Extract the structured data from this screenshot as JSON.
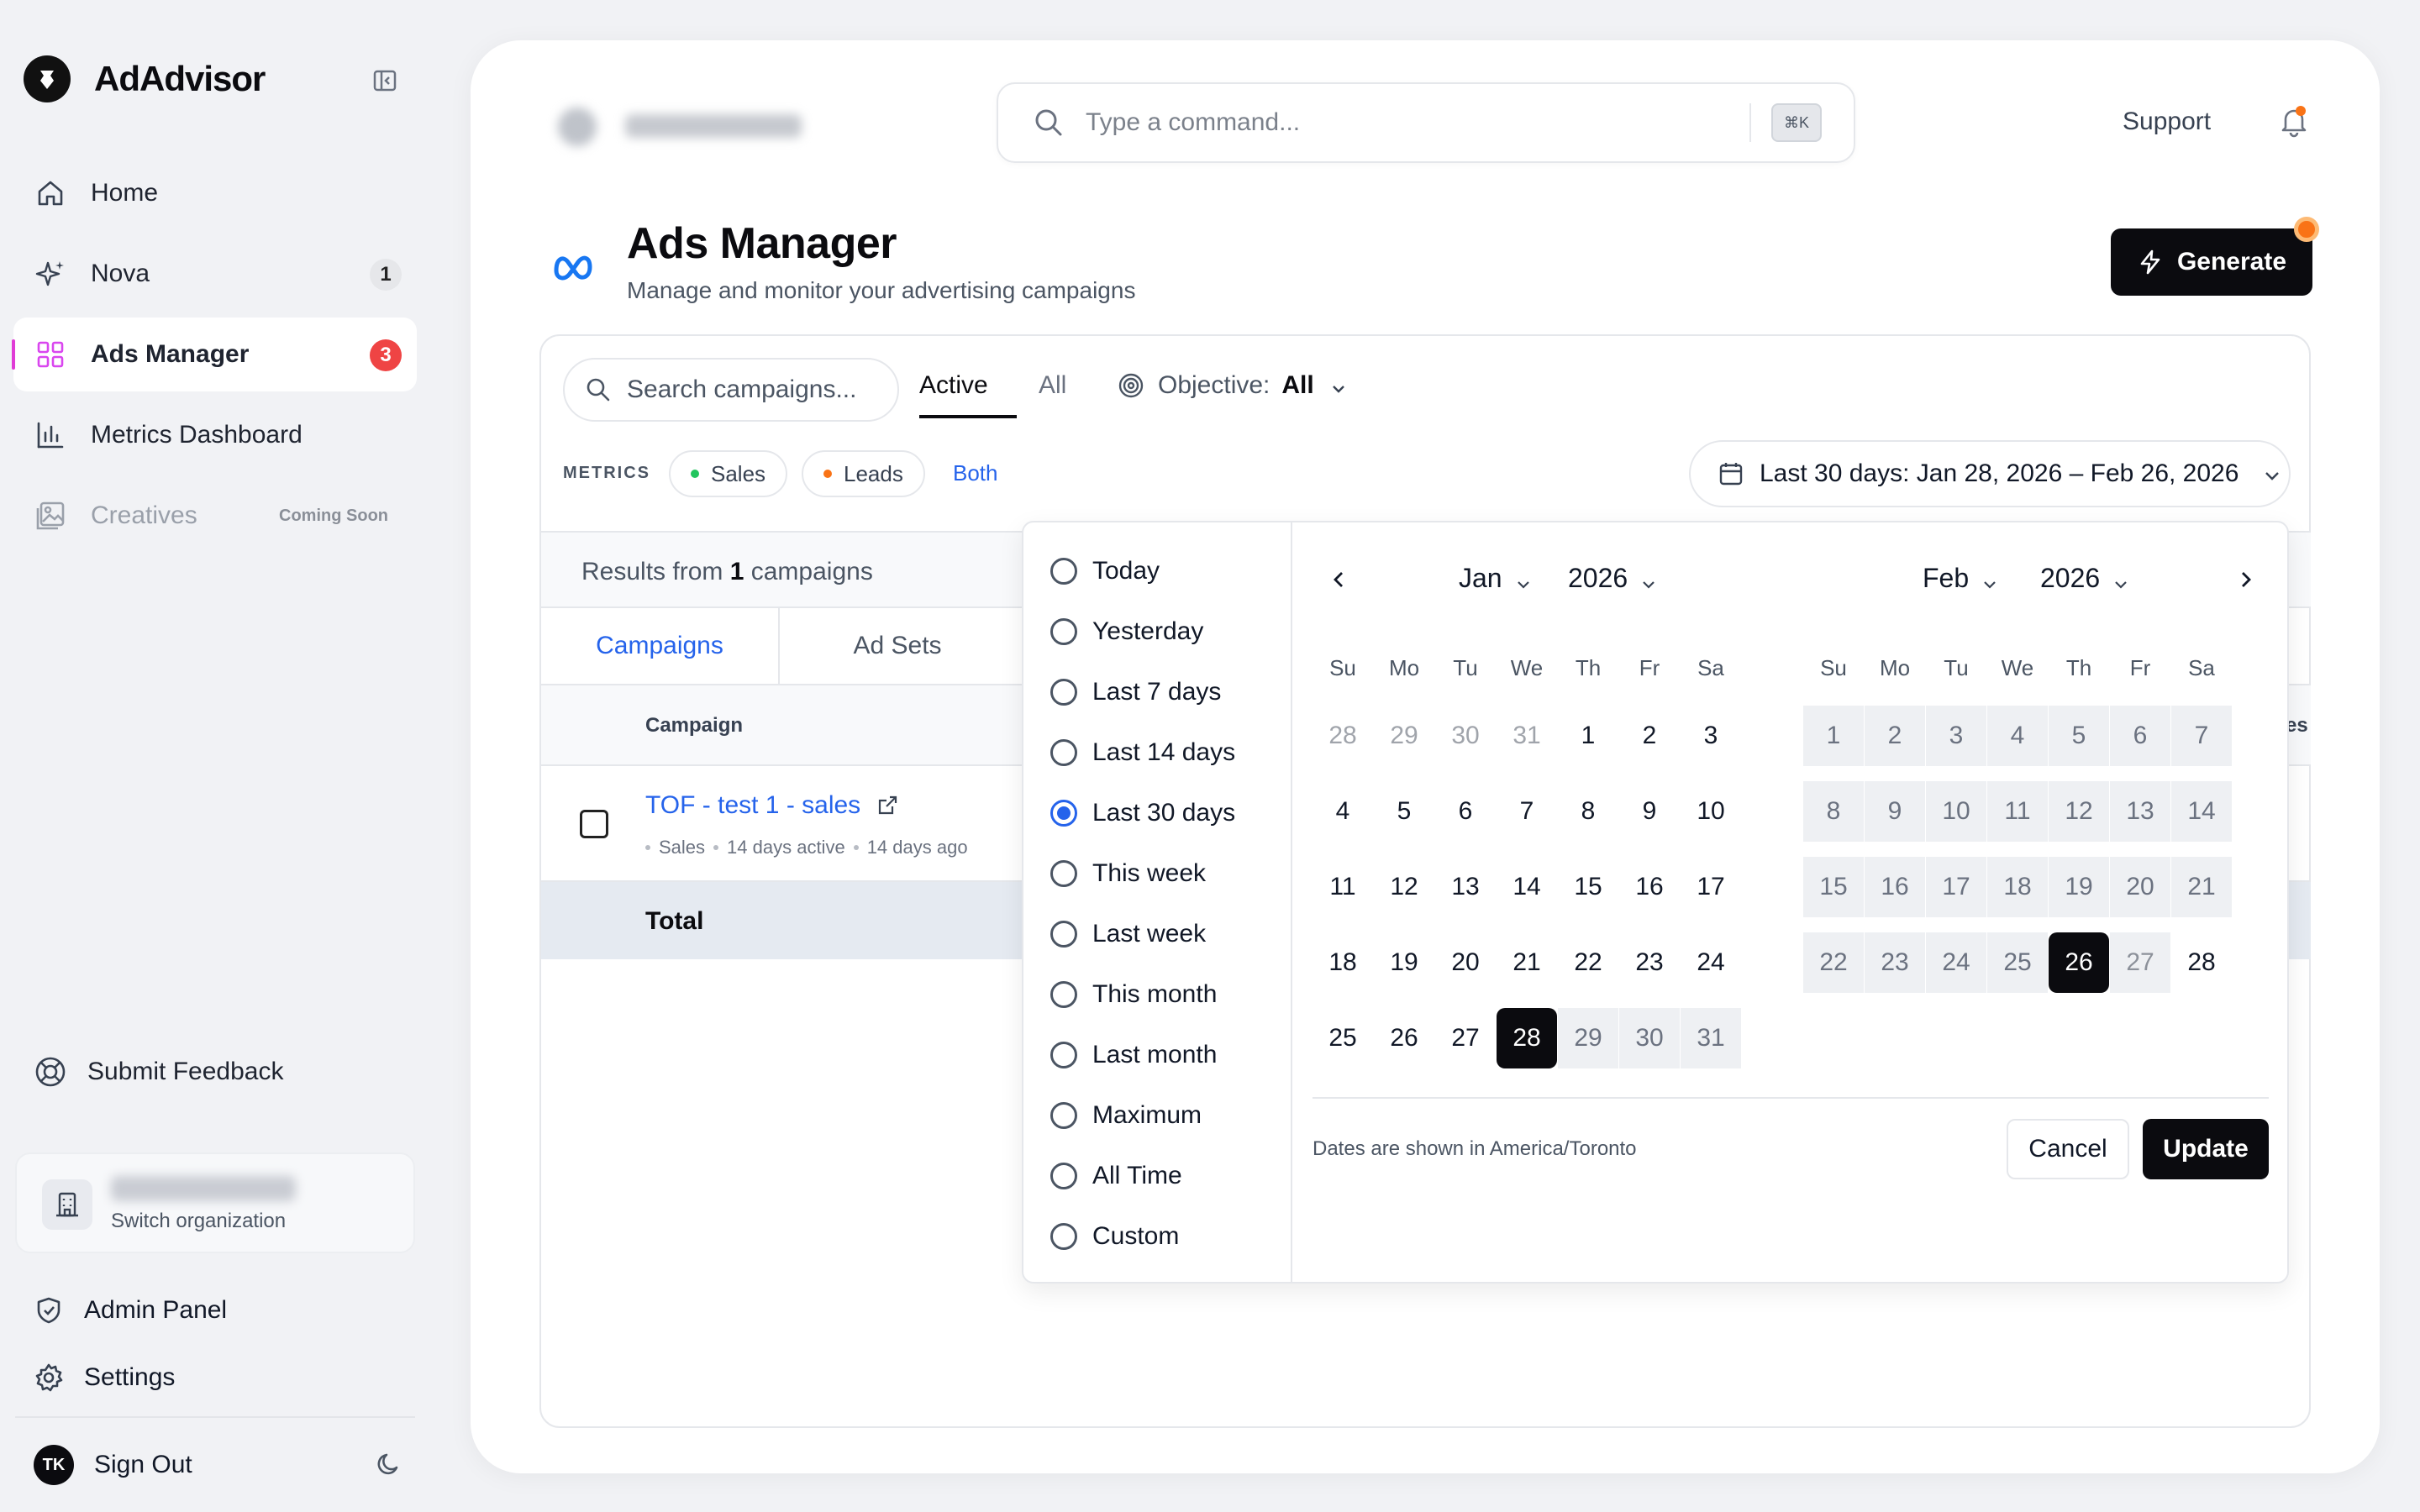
{
  "app": {
    "name": "AdAdvisor"
  },
  "sidebar": {
    "items": [
      {
        "label": "Home",
        "icon": "home-icon",
        "badge": ""
      },
      {
        "label": "Nova",
        "icon": "sparkle-icon",
        "badge": "1"
      },
      {
        "label": "Ads Manager",
        "icon": "grid-icon",
        "badge": "3",
        "active": true
      },
      {
        "label": "Metrics Dashboard",
        "icon": "bar-chart-icon",
        "badge": ""
      },
      {
        "label": "Creatives",
        "icon": "image-icon",
        "badge": "",
        "tag": "Coming Soon",
        "disabled": true
      }
    ],
    "feedback_label": "Submit Feedback",
    "org": {
      "switch_label": "Switch organization"
    },
    "admin_label": "Admin Panel",
    "settings_label": "Settings",
    "signout_label": "Sign Out",
    "avatar_initials": "TK"
  },
  "topbar": {
    "command_placeholder": "Type a command...",
    "shortcut": "⌘K",
    "support_label": "Support"
  },
  "page": {
    "title": "Ads Manager",
    "subtitle": "Manage and monitor your advertising campaigns",
    "generate_label": "Generate"
  },
  "filters": {
    "search_placeholder": "Search campaigns...",
    "tabs": [
      "Active",
      "All"
    ],
    "objective_label": "Objective:",
    "objective_value": "All",
    "metrics_label": "METRICS",
    "chips": [
      {
        "label": "Sales",
        "color": "#22c55e"
      },
      {
        "label": "Leads",
        "color": "#f97316"
      }
    ],
    "both_label": "Both",
    "date_range_label": "Last 30 days: Jan 28, 2026 – Feb 26, 2026"
  },
  "results": {
    "prefix": "Results from",
    "count": "1",
    "suffix": "campaigns",
    "subtabs": [
      "Campaigns",
      "Ad Sets"
    ],
    "column_campaign": "Campaign",
    "column_cut": "es",
    "rows": [
      {
        "name": "TOF - test 1 - sales",
        "objective": "Sales",
        "active": "14 days active",
        "created": "14 days ago"
      }
    ],
    "total_label": "Total"
  },
  "datepicker": {
    "presets": [
      "Today",
      "Yesterday",
      "Last 7 days",
      "Last 14 days",
      "Last 30 days",
      "This week",
      "Last week",
      "This month",
      "Last month",
      "Maximum",
      "All Time",
      "Custom"
    ],
    "selected_preset": "Last 30 days",
    "weekdays": [
      "Su",
      "Mo",
      "Tu",
      "We",
      "Th",
      "Fr",
      "Sa"
    ],
    "left": {
      "month": "Jan",
      "year": "2026"
    },
    "right": {
      "month": "Feb",
      "year": "2026"
    },
    "timezone_note": "Dates are shown in America/Toronto",
    "cancel_label": "Cancel",
    "update_label": "Update"
  }
}
